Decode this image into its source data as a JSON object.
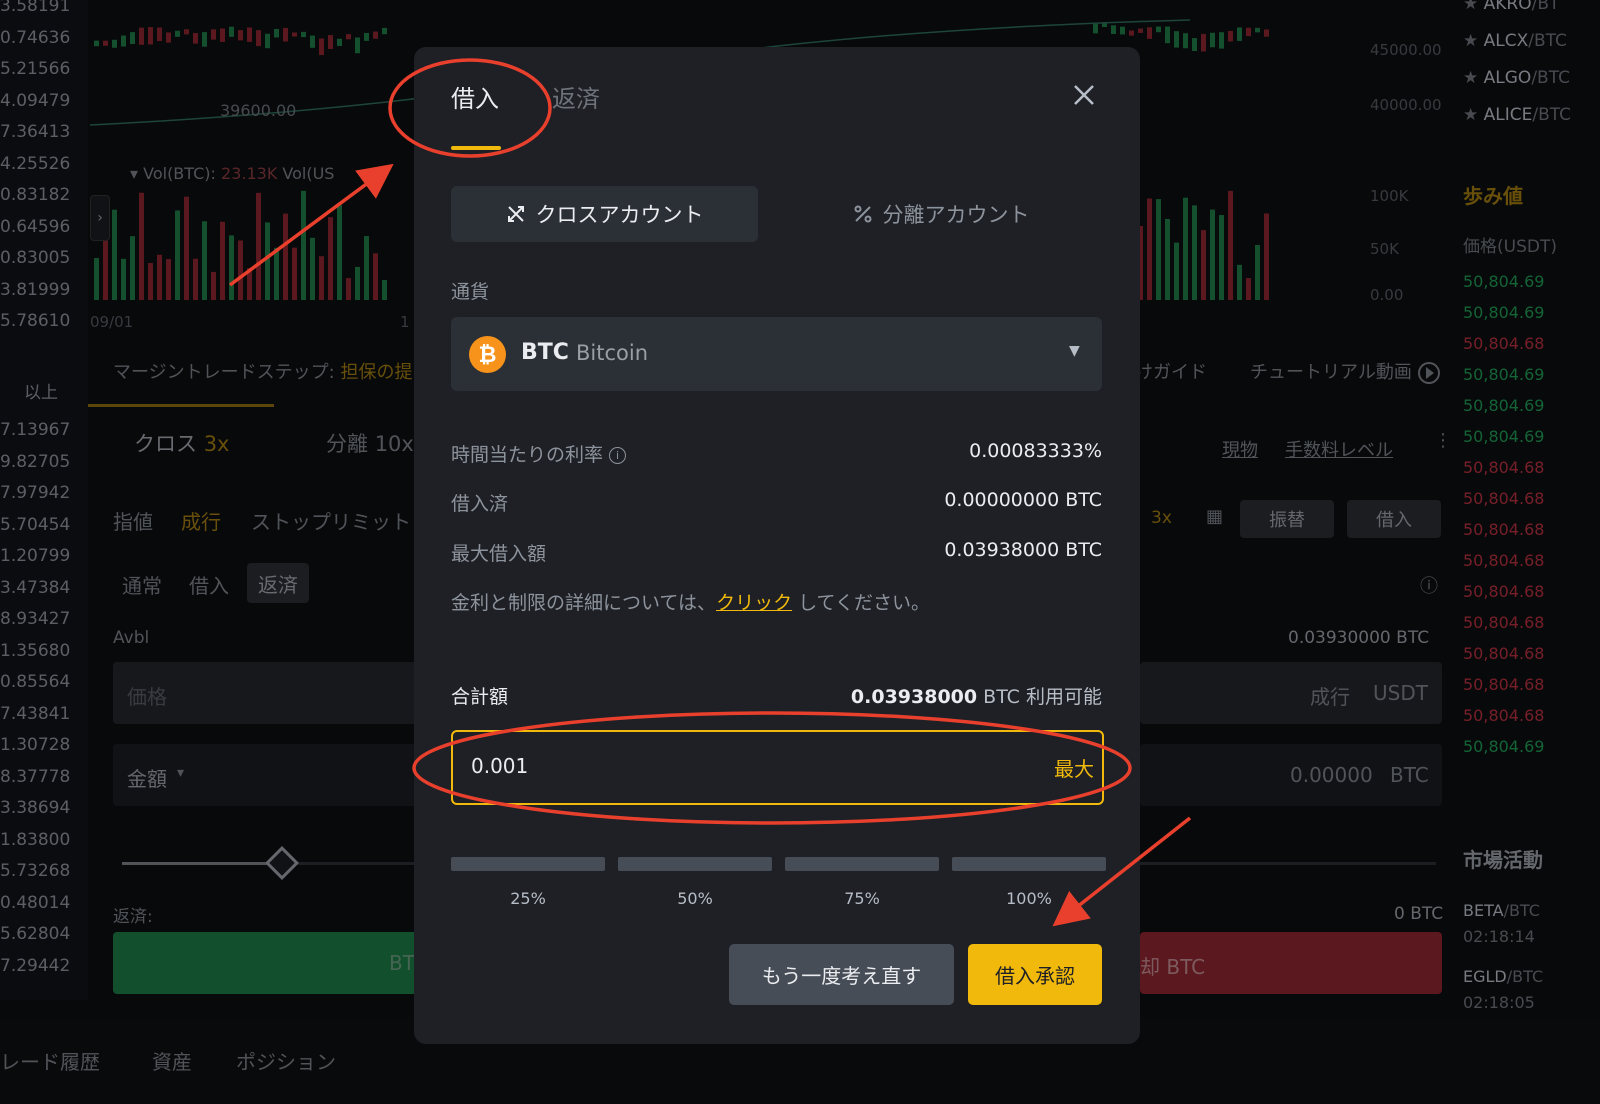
{
  "background": {
    "order_book_left": [
      "3.58191",
      "0.74636",
      "5.21566",
      "4.09479",
      "7.36413",
      "4.25526",
      "0.83182",
      "0.64596",
      "0.83005",
      "3.81999",
      "5.78610",
      "以上",
      "7.13967",
      "9.82705",
      "7.97942",
      "5.70454",
      "1.20799",
      "3.47384",
      "8.93427",
      "1.35680",
      "0.85564",
      "7.43841",
      "1.30728",
      "8.37778",
      "3.38694",
      "1.83800",
      "5.73268",
      "0.48014",
      "5.62804",
      "7.29442"
    ],
    "chart": {
      "price_marker": "39600.00",
      "axis_right": [
        "45000.00",
        "40000.00",
        "100K",
        "50K",
        "0.00"
      ],
      "vol_label": "Vol(BTC):",
      "vol_value": "23.13K",
      "vol_label2": "Vol(US",
      "date_left": "09/01",
      "date_mid": "1"
    },
    "margin_steps_label": "マージントレードステップ:",
    "margin_steps_link": "担保の提",
    "guide_link": "けガイド",
    "tutorial_link": "チュートリアル動画",
    "cross_tab": "クロス",
    "cross_leverage": "3x",
    "isolated_tab": "分離",
    "isolated_leverage": "10x",
    "spot_link": "現物",
    "fee_level_link": "手数料レベル",
    "order_types": [
      "指値",
      "成行",
      "ストップリミット"
    ],
    "modes": [
      "通常",
      "借入",
      "返済"
    ],
    "leverage_badge": "3x",
    "transfer_button": "振替",
    "borrow_button": "借入",
    "avbl_label": "Avbl",
    "avbl_value": "0.03930000 BTC",
    "price_placeholder": "価格",
    "price_market": "成行",
    "price_unit": "USDT",
    "amount_label": "金額",
    "amount_value": "0.00000",
    "amount_unit": "BTC",
    "repay_label": "返済:",
    "repay_value": "0 BTC",
    "buy_button_fragment": "BT",
    "sell_button_fragment": "却 BTC",
    "bottom_tabs": [
      "レード履歴",
      "資産",
      "ポジション"
    ],
    "watchlist": [
      {
        "base": "AKRO",
        "quote": "/BT"
      },
      {
        "base": "ALCX",
        "quote": "/BTC"
      },
      {
        "base": "ALGO",
        "quote": "/BTC"
      },
      {
        "base": "ALICE",
        "quote": "/BTC"
      }
    ],
    "trades_title": "歩み値",
    "trades_header": "価格(USDT)",
    "trades": [
      {
        "price": "50,804.69",
        "side": "buy"
      },
      {
        "price": "50,804.69",
        "side": "buy"
      },
      {
        "price": "50,804.68",
        "side": "sell"
      },
      {
        "price": "50,804.69",
        "side": "buy"
      },
      {
        "price": "50,804.69",
        "side": "buy"
      },
      {
        "price": "50,804.69",
        "side": "buy"
      },
      {
        "price": "50,804.68",
        "side": "sell"
      },
      {
        "price": "50,804.68",
        "side": "sell"
      },
      {
        "price": "50,804.68",
        "side": "sell"
      },
      {
        "price": "50,804.68",
        "side": "sell"
      },
      {
        "price": "50,804.68",
        "side": "sell"
      },
      {
        "price": "50,804.68",
        "side": "sell"
      },
      {
        "price": "50,804.68",
        "side": "sell"
      },
      {
        "price": "50,804.68",
        "side": "sell"
      },
      {
        "price": "50,804.68",
        "side": "sell"
      },
      {
        "price": "50,804.69",
        "side": "buy"
      }
    ],
    "market_activity_title": "市場活動",
    "market_activity": [
      {
        "base": "BETA",
        "quote": "/BTC",
        "time": "02:18:14"
      },
      {
        "base": "EGLD",
        "quote": "/BTC",
        "time": "02:18:05"
      }
    ]
  },
  "modal": {
    "tabs": {
      "borrow": "借入",
      "repay": "返済"
    },
    "account_cross": "クロスアカウント",
    "account_isolated": "分離アカウント",
    "currency_label": "通貨",
    "currency_symbol": "BTC",
    "currency_name": "Bitcoin",
    "coin_glyph": "₿",
    "hourly_rate_label": "時間当たりの利率",
    "hourly_rate_value": "0.00083333%",
    "borrowed_label": "借入済",
    "borrowed_value": "0.00000000 BTC",
    "max_borrow_label": "最大借入額",
    "max_borrow_value": "0.03938000 BTC",
    "details_prefix": "金利と制限の詳細については、",
    "details_link": "クリック",
    "details_suffix": "してください。",
    "total_label": "合計額",
    "available_amount": "0.03938000",
    "available_suffix": "BTC 利用可能",
    "amount_input_value": "0.001",
    "max_button": "最大",
    "percentages": [
      "25%",
      "50%",
      "75%",
      "100%"
    ],
    "reconsider_button": "もう一度考え直す",
    "confirm_button": "借入承認"
  },
  "colors": {
    "accent": "#f0b90b",
    "buy": "#1f9a54",
    "sell": "#b7313f",
    "annotation": "#e8402c"
  }
}
